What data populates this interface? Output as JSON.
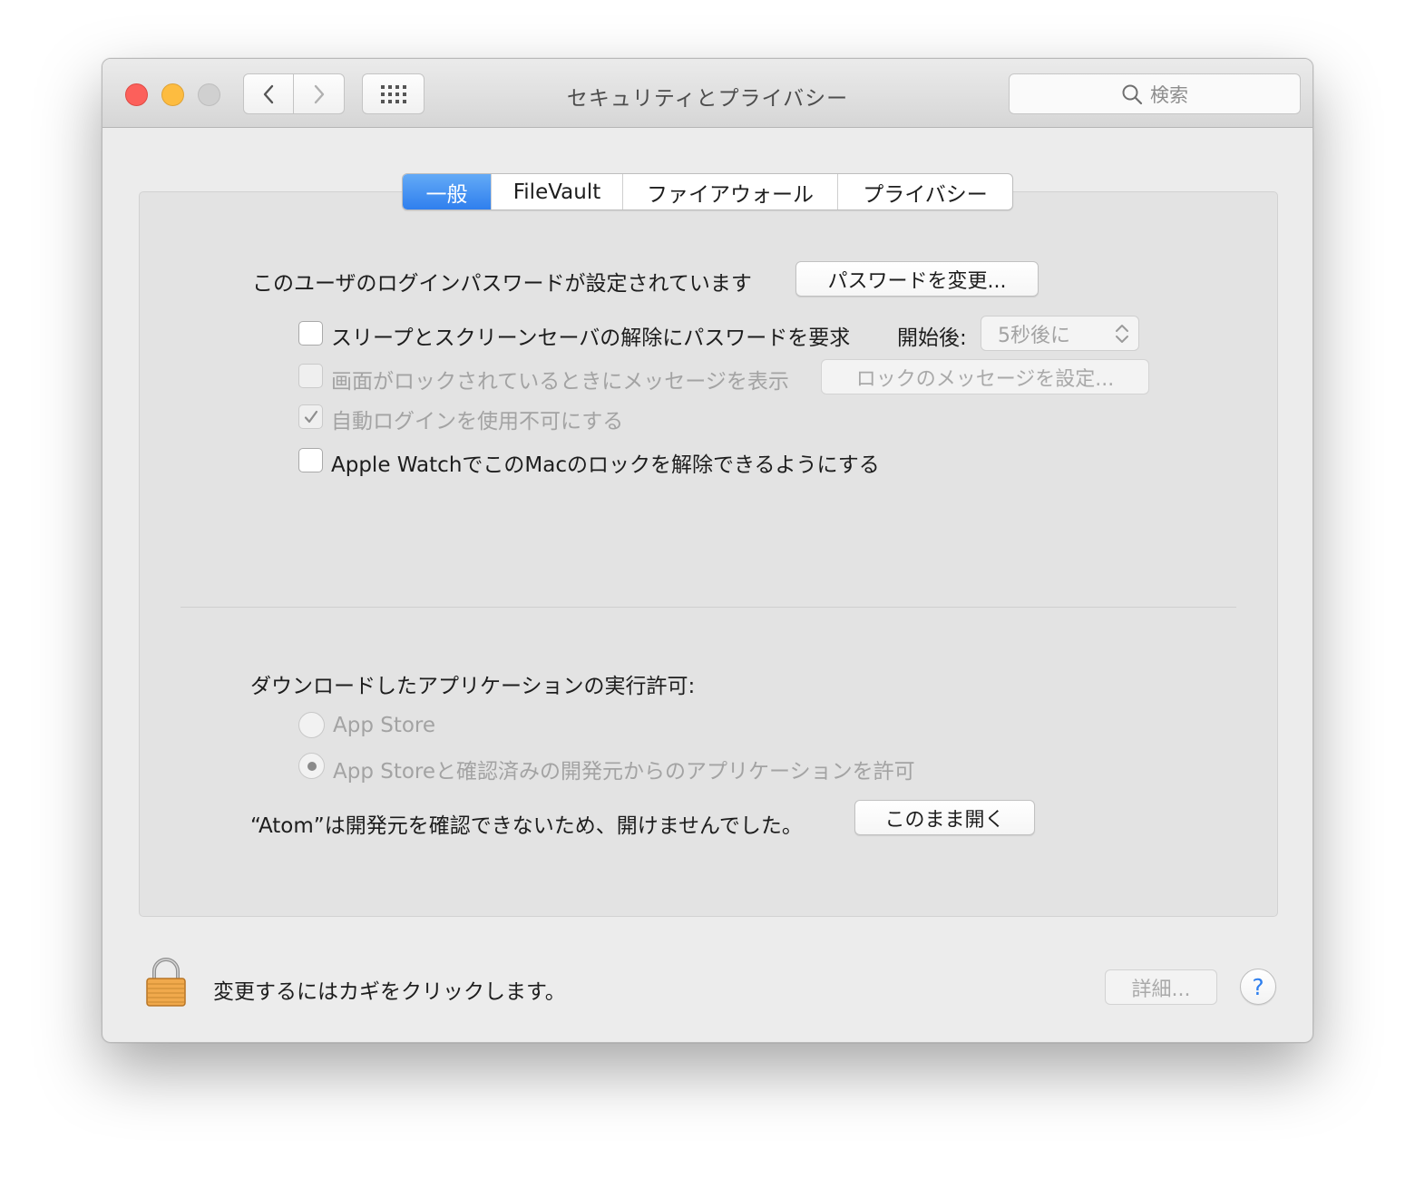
{
  "window": {
    "title": "セキュリティとプライバシー"
  },
  "toolbar": {
    "back_icon": "chevron-left-icon",
    "forward_icon": "chevron-right-icon",
    "grid_icon": "grid-icon",
    "search_placeholder": "検索",
    "search_icon": "magnifier-icon"
  },
  "tabs": [
    {
      "label": "一般",
      "active": true
    },
    {
      "label": "FileVault",
      "active": false
    },
    {
      "label": "ファイアウォール",
      "active": false
    },
    {
      "label": "プライバシー",
      "active": false
    }
  ],
  "general": {
    "password_status": "このユーザのログインパスワードが設定されています",
    "change_password_button": "パスワードを変更...",
    "require_password": {
      "label": "スリープとスクリーンセーバの解除にパスワードを要求",
      "checked": false
    },
    "start_after_label": "開始後:",
    "start_after_value": "5秒後に",
    "show_message": {
      "label": "画面がロックされているときにメッセージを表示",
      "checked": false,
      "enabled": false
    },
    "set_lock_message_button": "ロックのメッセージを設定...",
    "disable_auto_login": {
      "label": "自動ログインを使用不可にする",
      "checked": true,
      "enabled": false
    },
    "apple_watch_unlock": {
      "label": "Apple WatchでこのMacのロックを解除できるようにする",
      "checked": false
    }
  },
  "downloads": {
    "heading": "ダウンロードしたアプリケーションの実行許可:",
    "options": [
      {
        "label": "App Store",
        "selected": false
      },
      {
        "label": "App Storeと確認済みの開発元からのアプリケーションを許可",
        "selected": true
      }
    ],
    "blocked_message": "“Atom”は開発元を確認できないため、開けませんでした。",
    "open_anyway_button": "このまま開く"
  },
  "footer": {
    "lock_text": "変更するにはカギをクリックします。",
    "advanced_button": "詳細...",
    "help_label": "?"
  },
  "colors": {
    "accent": "#2f7fee",
    "close": "#fc605b",
    "minimize": "#fdbc40",
    "zoom_disabled": "#d0d0d0"
  }
}
